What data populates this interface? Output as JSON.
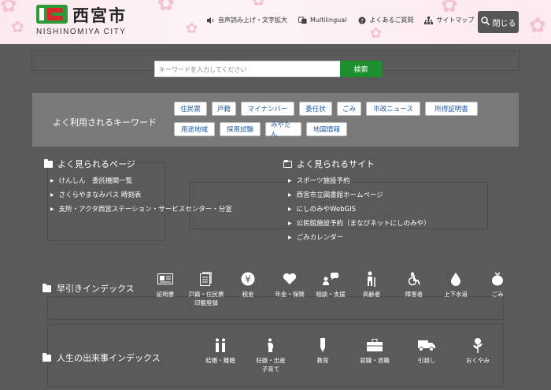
{
  "header": {
    "site_name": "西宮市",
    "site_name_en": "NISHINOMIYA CITY",
    "links": [
      {
        "label": "音声読み上げ・文字拡大",
        "icon": "speaker-icon"
      },
      {
        "label": "Multilingual",
        "icon": "translate-icon"
      },
      {
        "label": "よくあるご質問",
        "icon": "question-icon"
      },
      {
        "label": "サイトマップ",
        "icon": "sitemap-icon"
      }
    ],
    "close_label": "閉じる"
  },
  "search": {
    "placeholder": "キーワードを入力してください",
    "button_label": "検索"
  },
  "keywords": {
    "title": "よく利用されるキーワード",
    "row1": [
      "住民票",
      "戸籍",
      "マイナンバー",
      "委任状",
      "ごみ",
      "市政ニュース",
      "所得証明書"
    ],
    "row2": [
      "用途地域",
      "採用試験",
      "みやたん",
      "地図情報"
    ]
  },
  "popular_pages": {
    "title": "よく見られるページ",
    "items": [
      "けんしん　委託機関一覧",
      "さくらやまなみバス 時刻表",
      "支所・アクタ西宮ステーション・サービスセンター・分室"
    ]
  },
  "popular_sites": {
    "title": "よく見られるサイト",
    "items": [
      "スポーツ施設予約",
      "西宮市立図書館ホームページ",
      "にしのみやWebGIS",
      "公民館施設予約（まなびネットにしのみや）",
      "ごみカレンダー"
    ]
  },
  "quick_index": {
    "title": "早引きインデックス",
    "items": [
      {
        "label": "証明書",
        "icon": "certificate-icon"
      },
      {
        "label": "戸籍・住民票\n印鑑登録",
        "icon": "document-icon"
      },
      {
        "label": "税金",
        "icon": "yen-icon"
      },
      {
        "label": "年金・保険",
        "icon": "heart-icon"
      },
      {
        "label": "相談・支援",
        "icon": "consultation-icon"
      },
      {
        "label": "高齢者",
        "icon": "elderly-icon"
      },
      {
        "label": "障害者",
        "icon": "wheelchair-icon"
      },
      {
        "label": "上下水道",
        "icon": "water-drop-icon"
      },
      {
        "label": "ごみ",
        "icon": "garbage-bag-icon"
      }
    ]
  },
  "life_index": {
    "title": "人生の出来事インデックス",
    "items": [
      {
        "label": "結婚・離婚",
        "icon": "couple-icon"
      },
      {
        "label": "妊娠・出産\n子育て",
        "icon": "pregnancy-icon"
      },
      {
        "label": "教育",
        "icon": "pencil-icon"
      },
      {
        "label": "就職・退職",
        "icon": "briefcase-icon"
      },
      {
        "label": "引越し",
        "icon": "truck-icon"
      },
      {
        "label": "おくやみ",
        "icon": "flower-icon"
      }
    ]
  },
  "colors": {
    "accent_green": "#1e8f2e",
    "overlay": "#5a5a5a",
    "keyword_text": "#1e5aa8"
  }
}
